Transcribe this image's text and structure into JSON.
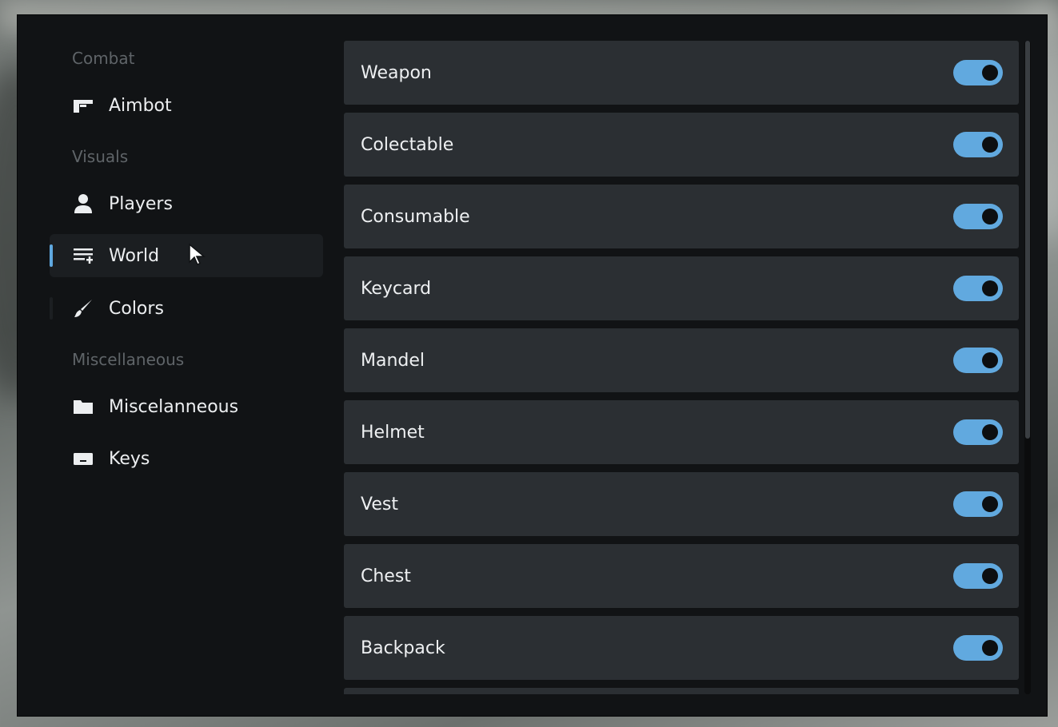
{
  "sidebar": {
    "sections": [
      {
        "label": "Combat",
        "items": [
          {
            "label": "Aimbot",
            "icon": "gun-icon"
          }
        ]
      },
      {
        "label": "Visuals",
        "items": [
          {
            "label": "Players",
            "icon": "user-icon"
          },
          {
            "label": "World",
            "icon": "list-add-icon",
            "active": true
          },
          {
            "label": "Colors",
            "icon": "brush-icon"
          }
        ]
      },
      {
        "label": "Miscellaneous",
        "items": [
          {
            "label": "Miscelanneous",
            "icon": "folder-icon"
          },
          {
            "label": "Keys",
            "icon": "keyboard-icon"
          }
        ]
      }
    ]
  },
  "options": [
    {
      "label": "Weapon",
      "enabled": true
    },
    {
      "label": "Colectable",
      "enabled": true
    },
    {
      "label": "Consumable",
      "enabled": true
    },
    {
      "label": "Keycard",
      "enabled": true
    },
    {
      "label": "Mandel",
      "enabled": true
    },
    {
      "label": "Helmet",
      "enabled": true
    },
    {
      "label": "Vest",
      "enabled": true
    },
    {
      "label": "Chest",
      "enabled": true
    },
    {
      "label": "Backpack",
      "enabled": true
    }
  ],
  "colors": {
    "accent": "#61a9df",
    "panel": "#111315",
    "row": "#2b2f33"
  }
}
